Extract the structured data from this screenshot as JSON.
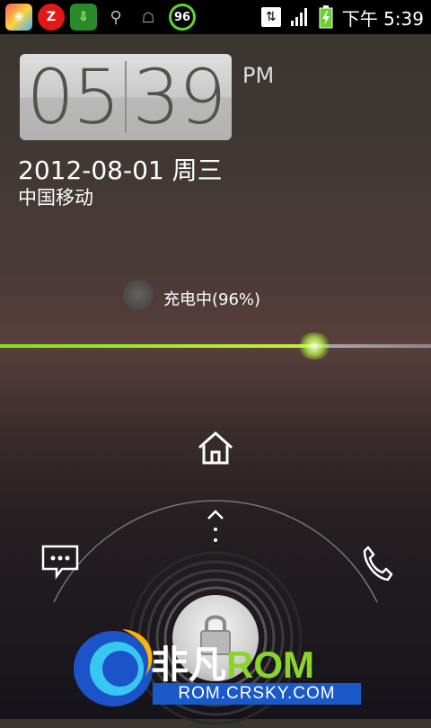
{
  "status_bar": {
    "time": "下午 5:39",
    "battery_level": "96",
    "icons": [
      "app-icon-colorful",
      "app-icon-z",
      "download-icon",
      "usb-icon",
      "android-icon",
      "battery-circle-icon",
      "data-sync-icon",
      "signal-icon",
      "battery-icon"
    ]
  },
  "clock": {
    "hours": "05",
    "minutes": "39",
    "ampm": "PM"
  },
  "date": "2012-08-01 周三",
  "carrier": "中国移动",
  "charging": {
    "text": "充电中(96%)",
    "percent": 96
  },
  "actions": {
    "home": "home-icon",
    "up": "up-arrow-icon",
    "sms": "message-icon",
    "phone": "phone-icon",
    "lock": "lock-icon"
  },
  "watermark": {
    "brand_cn": "非凡",
    "brand_en": "ROM",
    "url": "ROM.CRSKY.COM"
  }
}
